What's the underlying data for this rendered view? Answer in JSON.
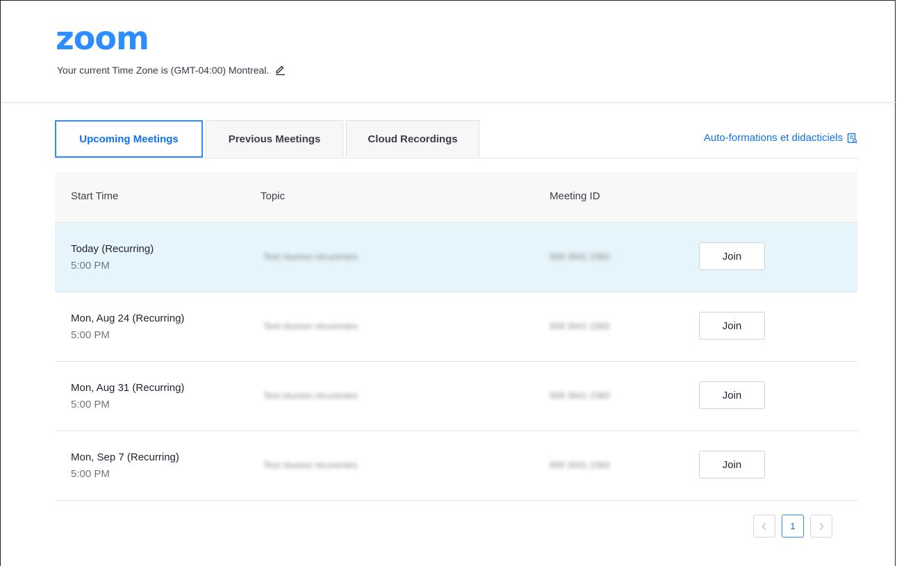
{
  "header": {
    "logo_text": "zoom",
    "timezone_text": "Your current Time Zone is (GMT-04:00) Montreal."
  },
  "tabs": [
    {
      "label": "Upcoming Meetings",
      "active": true
    },
    {
      "label": "Previous Meetings",
      "active": false
    },
    {
      "label": "Cloud Recordings",
      "active": false
    }
  ],
  "help_link": {
    "label": "Auto-formations et didacticiels",
    "icon": "document-icon"
  },
  "table": {
    "headers": {
      "start_time": "Start Time",
      "topic": "Topic",
      "meeting_id": "Meeting ID"
    },
    "join_label": "Join",
    "rows": [
      {
        "date": "Today (Recurring)",
        "time": "5:00 PM",
        "topic": "Test réunion récurentes",
        "meeting_id": "958 3941 2360"
      },
      {
        "date": "Mon, Aug 24 (Recurring)",
        "time": "5:00 PM",
        "topic": "Test réunion récurentes",
        "meeting_id": "958 3941 2360"
      },
      {
        "date": "Mon, Aug 31 (Recurring)",
        "time": "5:00 PM",
        "topic": "Test réunion récurentes",
        "meeting_id": "958 3941 2360"
      },
      {
        "date": "Mon, Sep 7 (Recurring)",
        "time": "5:00 PM",
        "topic": "Test réunion récurentes",
        "meeting_id": "958 3941 2360"
      }
    ]
  },
  "pagination": {
    "current_page": "1"
  },
  "colors": {
    "brand": "#2d8cff",
    "link": "#0e72ed",
    "row_highlight": "#e6f4fb"
  }
}
